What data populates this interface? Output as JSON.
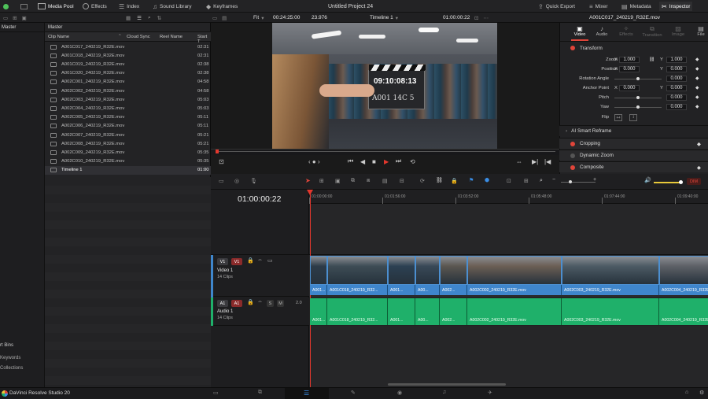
{
  "topbar": {
    "media_pool": "Media Pool",
    "effects": "Effects",
    "index": "Index",
    "sound_library": "Sound Library",
    "keyframes": "Keyframes",
    "project_title": "Untitled Project 24",
    "quick_export": "Quick Export",
    "mixer": "Mixer",
    "metadata": "Metadata",
    "inspector": "Inspector"
  },
  "subbar": {
    "fit": "Fit",
    "timecode_duration": "00:24:25:00",
    "fps": "23.976",
    "timeline_name": "Timeline 1",
    "timecode_current": "01:00:00:22",
    "clip_name": "A001C017_240219_R32E.mov"
  },
  "left_panel": {
    "master_label": "Master",
    "smart_bins": "rt Bins",
    "keywords": "Keywords",
    "collections": "Collections"
  },
  "media_pool": {
    "header": "Master",
    "columns": [
      "Clip Name",
      "Cloud Sync",
      "Reel Name",
      "Start T"
    ],
    "clips": [
      {
        "name": "A001C017_240219_R32E.mov",
        "start": "02:31"
      },
      {
        "name": "A001C018_240219_R32E.mov",
        "start": "02:31"
      },
      {
        "name": "A001C019_240219_R32E.mov",
        "start": "02:38"
      },
      {
        "name": "A001C020_240219_R32E.mov",
        "start": "02:38"
      },
      {
        "name": "A002C001_240219_R32E.mov",
        "start": "04:58"
      },
      {
        "name": "A002C002_240219_R32E.mov",
        "start": "04:58"
      },
      {
        "name": "A002C003_240219_R32E.mov",
        "start": "05:03"
      },
      {
        "name": "A002C004_240219_R32E.mov",
        "start": "05:03"
      },
      {
        "name": "A002C005_240219_R32E.mov",
        "start": "05:11"
      },
      {
        "name": "A002C006_240219_R32E.mov",
        "start": "05:11"
      },
      {
        "name": "A002C007_240219_R32E.mov",
        "start": "05:21"
      },
      {
        "name": "A002C008_240219_R32E.mov",
        "start": "05:21"
      },
      {
        "name": "A002C009_240219_R32E.mov",
        "start": "05:35"
      },
      {
        "name": "A002C010_240219_R32E.mov",
        "start": "05:35"
      },
      {
        "name": "Timeline 1",
        "start": "01:00"
      }
    ]
  },
  "viewer": {
    "slate_time": "09:10:08:13",
    "slate_text": "A001 14C 5"
  },
  "inspector": {
    "tabs": [
      "Video",
      "Audio",
      "Effects",
      "Transition",
      "Image",
      "File"
    ],
    "transform": "Transform",
    "zoom": "Zoom",
    "position": "Position",
    "rotation_angle": "Rotation Angle",
    "anchor_point": "Anchor Point",
    "pitch": "Pitch",
    "yaw": "Yaw",
    "flip": "Flip",
    "x": "X",
    "y": "Y",
    "zoom_x": "1.000",
    "zoom_y": "1.000",
    "pos_x": "0.000",
    "pos_y": "0.000",
    "rot_value": "0.000",
    "anchor_x": "0.000",
    "anchor_y": "0.000",
    "pitch_value": "0.000",
    "yaw_value": "0.000",
    "ai_smart_reframe": "AI Smart Reframe",
    "cropping": "Cropping",
    "dynamic_zoom": "Dynamic Zoom",
    "composite": "Composite"
  },
  "timeline": {
    "current_tc": "01:00:00:22",
    "dim": "DIM",
    "ticks": [
      "01:00:00:00",
      "01:01:56:00",
      "01:03:52:00",
      "01:05:48:00",
      "01:07:44:00",
      "01:09:40:00"
    ],
    "v1_label": "V1",
    "video_track_name": "Video 1",
    "video_track_clips": "14 Clips",
    "a1_label": "A1",
    "audio_track_name": "Audio 1",
    "audio_track_clips": "14 Clips",
    "audio_channel": "2.0",
    "solo": "S",
    "mute": "M",
    "video_clips": [
      "A001...",
      "A001C018_240219_R32...",
      "A001...",
      "A00...",
      "A002...",
      "A002C002_240219_R32E.mov",
      "A002C003_240219_R32E.mov",
      "A002C004_240219_R32E"
    ],
    "audio_clips": [
      "A001...",
      "A001C018_240219_R32...",
      "A001...",
      "A00...",
      "A002...",
      "A002C002_240219_R32E.mov",
      "A002C003_240219_R32E.mov",
      "A002C004_240219_R32E"
    ]
  },
  "bottombar": {
    "app_name": "DaVinci Resolve Studio 20"
  },
  "colors": {
    "accent_red": "#e0453a",
    "video_clip": "#3f86cc",
    "audio_clip": "#1fb06a",
    "playhead": "#e3372d"
  }
}
